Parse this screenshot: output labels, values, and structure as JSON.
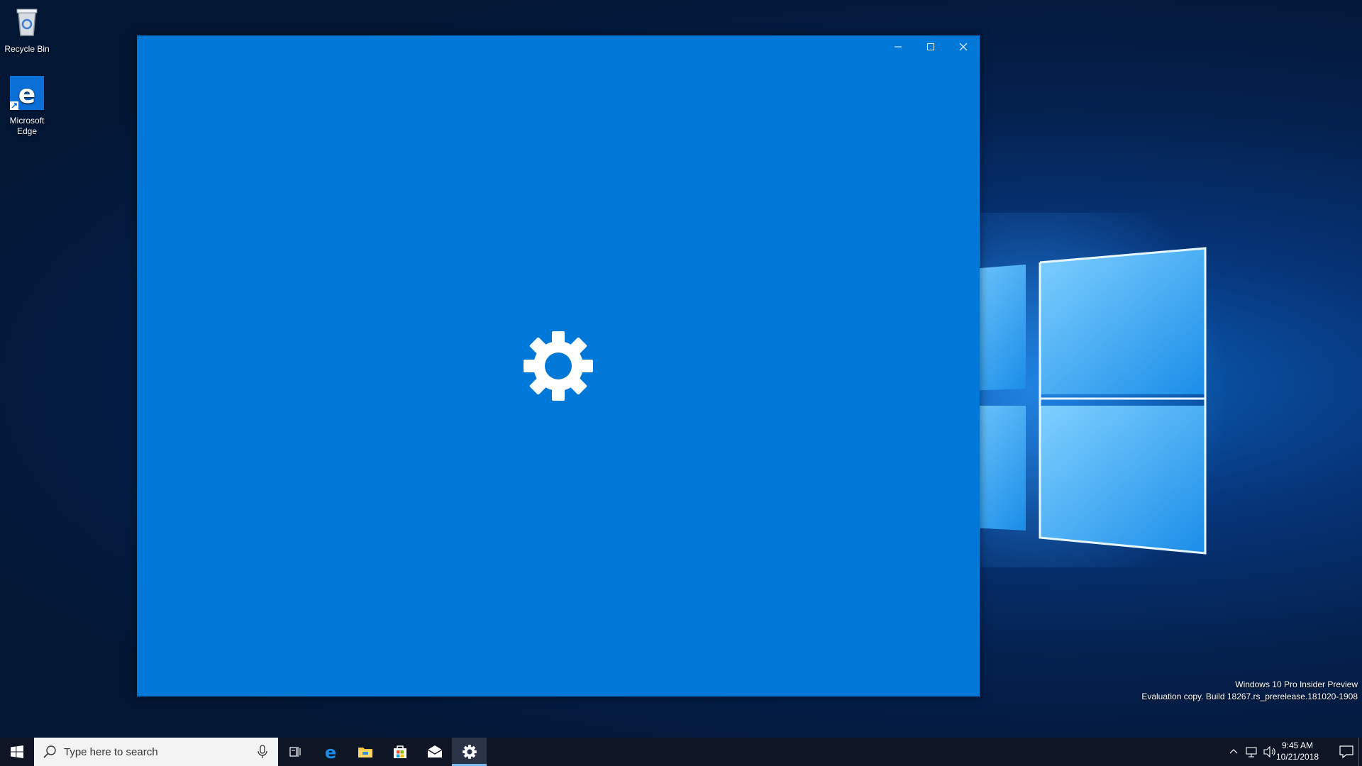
{
  "desktop": {
    "icons": [
      {
        "label": "Recycle Bin",
        "icon": "recycle-bin-icon"
      },
      {
        "label": "Microsoft Edge",
        "icon": "edge-icon"
      }
    ],
    "watermark": {
      "line1": "Windows 10 Pro Insider Preview",
      "line2": "Evaluation copy. Build 18267.rs_prerelease.181020-1908"
    },
    "wallpaper": "windows-10-hero"
  },
  "window": {
    "title": "",
    "background": "#0078d7",
    "caption_buttons": [
      "minimize",
      "maximize",
      "close"
    ],
    "splash_icon": "gear-icon"
  },
  "taskbar": {
    "search_placeholder": "Type here to search",
    "pinned": [
      {
        "name": "task-view",
        "icon": "task-view-icon"
      },
      {
        "name": "edge",
        "icon": "edge-icon"
      },
      {
        "name": "file-explorer",
        "icon": "folder-icon"
      },
      {
        "name": "store",
        "icon": "store-icon"
      },
      {
        "name": "mail",
        "icon": "mail-icon"
      },
      {
        "name": "settings",
        "icon": "gear-icon",
        "active": true
      }
    ],
    "clock": {
      "time": "9:45 AM",
      "date": "10/21/2018"
    },
    "accent": "#76b9ed"
  }
}
